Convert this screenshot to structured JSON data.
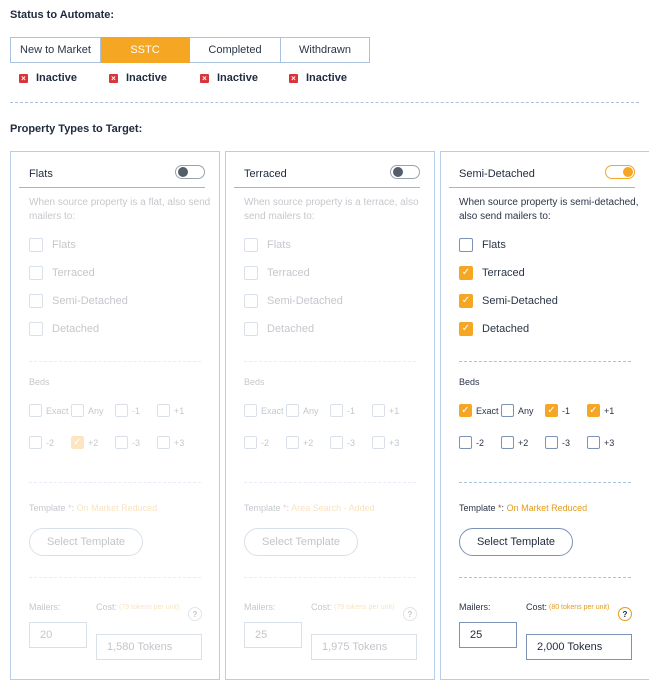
{
  "status_section": {
    "title": "Status to Automate:",
    "segments": [
      {
        "label": "New to Market",
        "active": false
      },
      {
        "label": "SSTC",
        "active": true
      },
      {
        "label": "Completed",
        "active": false
      },
      {
        "label": "Withdrawn",
        "active": false
      }
    ],
    "statuses": [
      "Inactive",
      "Inactive",
      "Inactive",
      "Inactive"
    ]
  },
  "types_section": {
    "title": "Property Types to Target:"
  },
  "cards": [
    {
      "name": "Flats",
      "enabled": false,
      "description": "When source property is a flat, also send mailers to:",
      "options": [
        {
          "label": "Flats",
          "checked": false
        },
        {
          "label": "Terraced",
          "checked": false
        },
        {
          "label": "Semi-Detached",
          "checked": false
        },
        {
          "label": "Detached",
          "checked": false
        }
      ],
      "beds_label": "Beds",
      "beds": [
        {
          "label": "Exact",
          "checked": false
        },
        {
          "label": "Any",
          "checked": false
        },
        {
          "label": "-1",
          "checked": false
        },
        {
          "label": "+1",
          "checked": false
        },
        {
          "label": "-2",
          "checked": false
        },
        {
          "label": "+2",
          "checked": true
        },
        {
          "label": "-3",
          "checked": false
        },
        {
          "label": "+3",
          "checked": false
        }
      ],
      "template_label": "Template",
      "template_star": " *",
      "template_sep": ": ",
      "template_value": "On Market Reduced",
      "template_button": "Select Template",
      "mailers_label": "Mailers:",
      "mailers_value": "20",
      "cost_label": "Cost:",
      "cost_note": "(79 tokens per unit)",
      "help": "?",
      "tokens_value": "1,580 Tokens"
    },
    {
      "name": "Terraced",
      "enabled": false,
      "description": "When source property is a terrace, also send mailers to:",
      "options": [
        {
          "label": "Flats",
          "checked": false
        },
        {
          "label": "Terraced",
          "checked": false
        },
        {
          "label": "Semi-Detached",
          "checked": false
        },
        {
          "label": "Detached",
          "checked": false
        }
      ],
      "beds_label": "Beds",
      "beds": [
        {
          "label": "Exact",
          "checked": false
        },
        {
          "label": "Any",
          "checked": false
        },
        {
          "label": "-1",
          "checked": false
        },
        {
          "label": "+1",
          "checked": false
        },
        {
          "label": "-2",
          "checked": false
        },
        {
          "label": "+2",
          "checked": false
        },
        {
          "label": "-3",
          "checked": false
        },
        {
          "label": "+3",
          "checked": false
        }
      ],
      "template_label": "Template",
      "template_star": " *",
      "template_sep": ": ",
      "template_value": "Area Search - Added",
      "template_button": "Select Template",
      "mailers_label": "Mailers:",
      "mailers_value": "25",
      "cost_label": "Cost:",
      "cost_note": "(79 tokens per unit)",
      "help": "?",
      "tokens_value": "1,975 Tokens"
    },
    {
      "name": "Semi-Detached",
      "enabled": true,
      "description": "When source property is semi-detached, also send mailers to:",
      "options": [
        {
          "label": "Flats",
          "checked": false
        },
        {
          "label": "Terraced",
          "checked": true
        },
        {
          "label": "Semi-Detached",
          "checked": true
        },
        {
          "label": "Detached",
          "checked": true
        }
      ],
      "beds_label": "Beds",
      "beds": [
        {
          "label": "Exact",
          "checked": true
        },
        {
          "label": "Any",
          "checked": false
        },
        {
          "label": "-1",
          "checked": true
        },
        {
          "label": "+1",
          "checked": true
        },
        {
          "label": "-2",
          "checked": false
        },
        {
          "label": "+2",
          "checked": false
        },
        {
          "label": "-3",
          "checked": false
        },
        {
          "label": "+3",
          "checked": false
        }
      ],
      "template_label": "Template",
      "template_star": " *",
      "template_sep": ": ",
      "template_value": "On Market Reduced",
      "template_button": "Select Template",
      "mailers_label": "Mailers:",
      "mailers_value": "25",
      "cost_label": "Cost:",
      "cost_note": "(80 tokens per unit)",
      "help": "?",
      "tokens_value": "2,000 Tokens"
    }
  ],
  "colors": {
    "accent": "#f5a623",
    "inactive_icon": "#d9343a",
    "border": "#b8cde6"
  }
}
